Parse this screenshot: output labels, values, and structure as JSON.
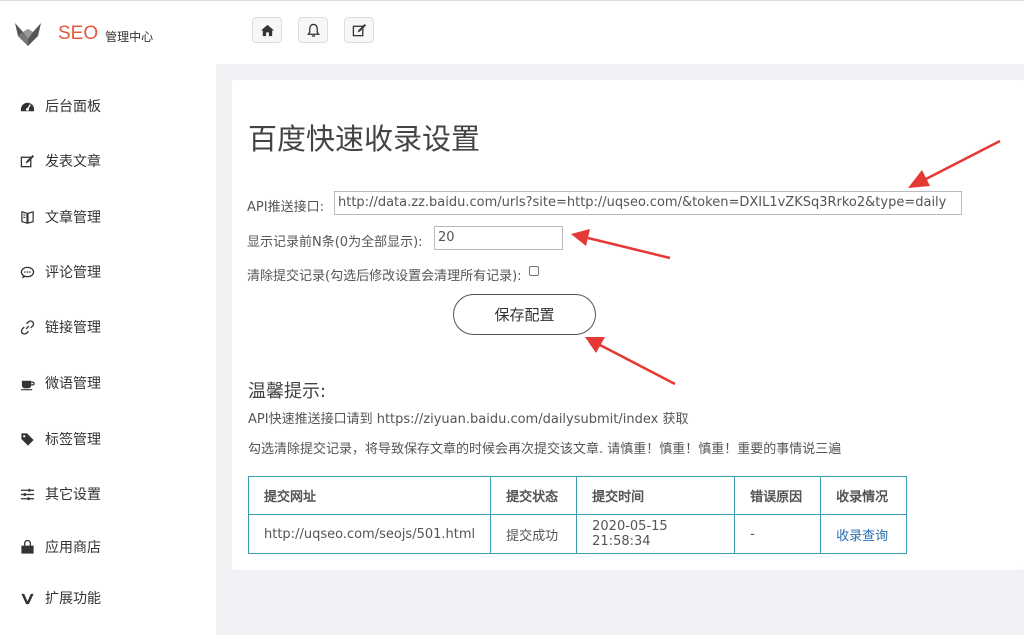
{
  "brand": {
    "name": "SEO",
    "subtitle": "管理中心"
  },
  "toolbar": {
    "icons": [
      "home-icon",
      "bell-icon",
      "edit-icon"
    ]
  },
  "sidebar": {
    "items": [
      {
        "label": "后台面板",
        "icon": "dashboard-icon"
      },
      {
        "label": "发表文章",
        "icon": "edit-icon"
      },
      {
        "label": "文章管理",
        "icon": "book-icon"
      },
      {
        "label": "评论管理",
        "icon": "comment-icon"
      },
      {
        "label": "链接管理",
        "icon": "link-icon"
      },
      {
        "label": "微语管理",
        "icon": "coffee-icon"
      },
      {
        "label": "标签管理",
        "icon": "tag-icon"
      },
      {
        "label": "其它设置",
        "icon": "sliders-icon"
      },
      {
        "label": "应用商店",
        "icon": "store-icon"
      },
      {
        "label": "扩展功能",
        "icon": "v-icon"
      }
    ]
  },
  "main": {
    "title": "百度快速收录设置",
    "api_label": "API推送接口:",
    "api_value": "http://data.zz.baidu.com/urls?site=http://uqseo.com/&token=DXIL1vZKSq3Rrko2&type=daily",
    "count_label": "显示记录前N条(0为全部显示):",
    "count_value": "20",
    "clear_label": "清除提交记录(勾选后修改设置会清理所有记录):",
    "clear_checked": false,
    "save_label": "保存配置",
    "tips_title": "温馨提示:",
    "tips": [
      "API快速推送接口请到 https://ziyuan.baidu.com/dailysubmit/index 获取",
      "勾选清除提交记录，将导致保存文章的时候会再次提交该文章. 请慎重！慎重！慎重！重要的事情说三遍"
    ]
  },
  "table": {
    "headers": [
      "提交网址",
      "提交状态",
      "提交时间",
      "错误原因",
      "收录情况"
    ],
    "rows": [
      [
        "http://uqseo.com/seojs/501.html",
        "提交成功",
        "2020-05-15 21:58:34",
        "-",
        "收录查询"
      ]
    ]
  },
  "colors": {
    "brand": "#e35a3c",
    "table_border": "#3a9bb0",
    "arrow": "#e53935",
    "link": "#2a6fb0"
  }
}
